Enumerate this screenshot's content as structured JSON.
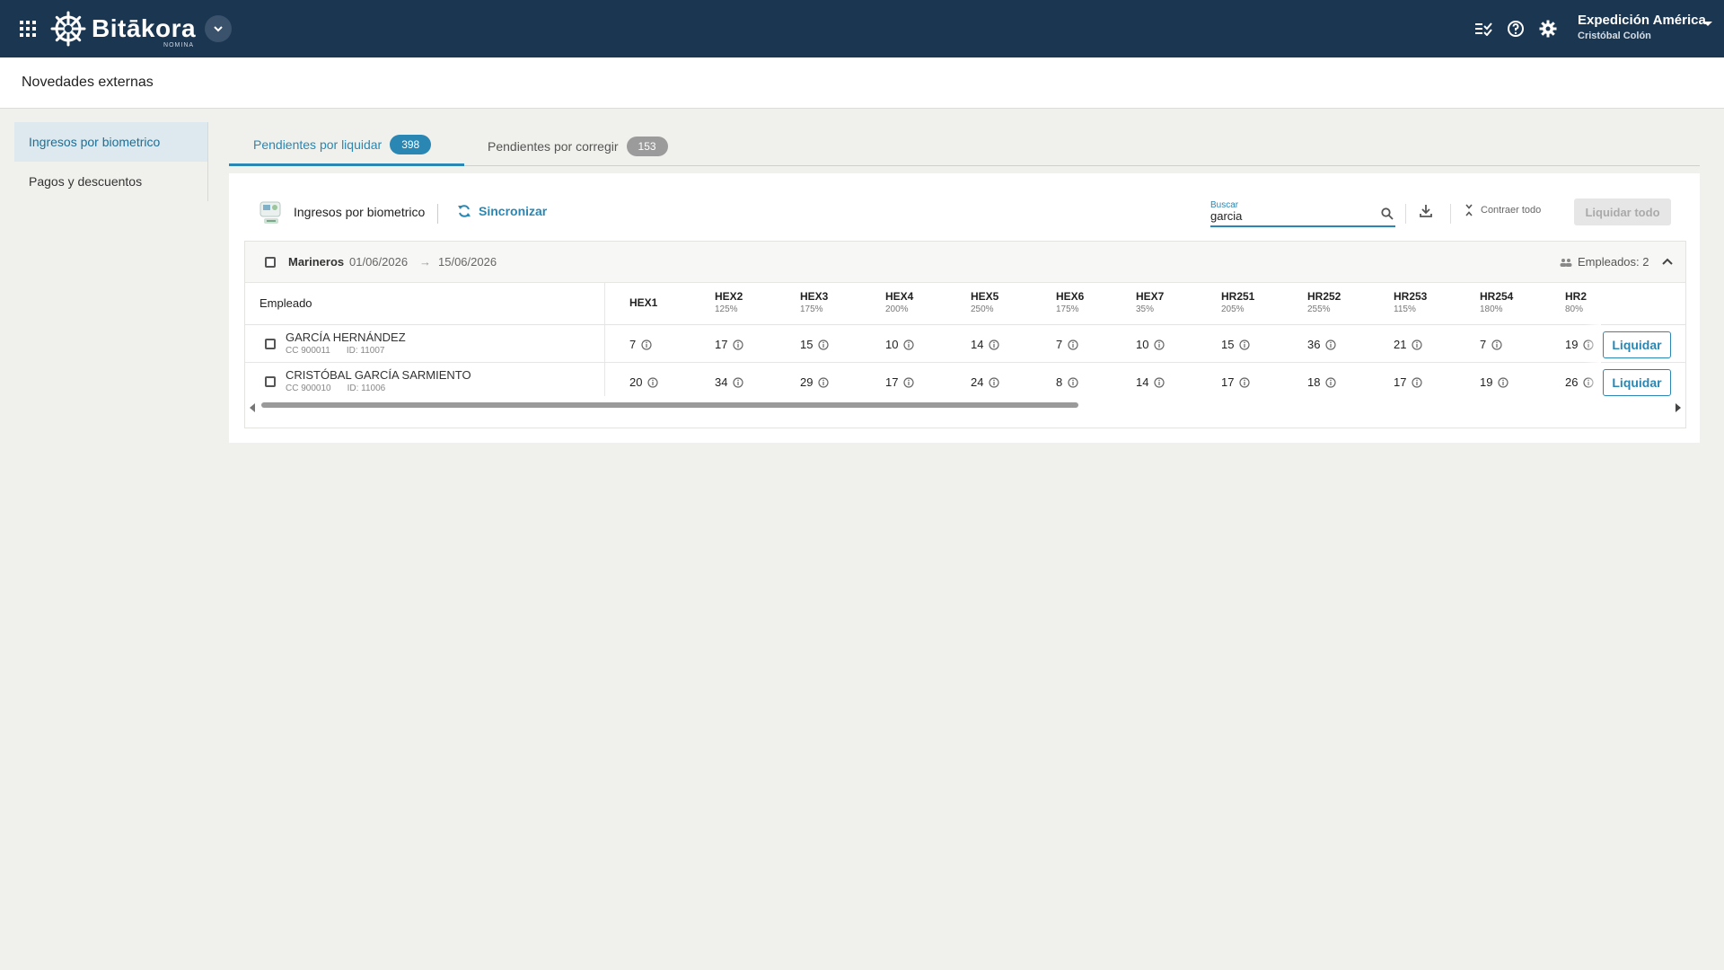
{
  "app": {
    "logo_name": "Bitākora",
    "logo_sub": "NOMINA",
    "company_name": "Expedición América",
    "user_name": "Cristóbal Colón",
    "icons": [
      "apps-grid-icon",
      "chevron-down-icon",
      "tasks-check-icon",
      "help-icon",
      "gear-icon",
      "caret-down-icon"
    ]
  },
  "page": {
    "title": "Novedades externas"
  },
  "sidebar": {
    "items": [
      {
        "label": "Ingresos por biometrico",
        "active": true
      },
      {
        "label": "Pagos y descuentos",
        "active": false
      }
    ]
  },
  "tabs": [
    {
      "label": "Pendientes por liquidar",
      "count": "398",
      "active": true
    },
    {
      "label": "Pendientes por corregir",
      "count": "153",
      "active": false
    }
  ],
  "toolbar": {
    "title": "Ingresos por biometrico",
    "sync_label": "Sincronizar",
    "search_label": "Buscar",
    "search_value": "garcia",
    "collapse_label": "Contraer todo",
    "liquidate_all_label": "Liquidar todo"
  },
  "group": {
    "name": "Marineros",
    "date_from": "01/06/2026",
    "arrow": "→",
    "date_to": "15/06/2026",
    "employees_label": "Empleados: 2"
  },
  "table": {
    "employee_header": "Empleado",
    "columns": [
      {
        "code": "HEX1",
        "pct": ""
      },
      {
        "code": "HEX2",
        "pct": "125%"
      },
      {
        "code": "HEX3",
        "pct": "175%"
      },
      {
        "code": "HEX4",
        "pct": "200%"
      },
      {
        "code": "HEX5",
        "pct": "250%"
      },
      {
        "code": "HEX6",
        "pct": "175%"
      },
      {
        "code": "HEX7",
        "pct": "35%"
      },
      {
        "code": "HR251",
        "pct": "205%"
      },
      {
        "code": "HR252",
        "pct": "255%"
      },
      {
        "code": "HR253",
        "pct": "115%"
      },
      {
        "code": "HR254",
        "pct": "180%"
      },
      {
        "code": "HR2",
        "pct": "80%"
      }
    ],
    "rows": [
      {
        "name": "GARCÍA HERNÁNDEZ",
        "cc": "CC 900011",
        "id": "ID: 11007",
        "values": [
          "7",
          "17",
          "15",
          "10",
          "14",
          "7",
          "10",
          "15",
          "36",
          "21",
          "7",
          "19"
        ],
        "action_label": "Liquidar"
      },
      {
        "name": "CRISTÓBAL GARCÍA SARMIENTO",
        "cc": "CC 900010",
        "id": "ID: 11006",
        "values": [
          "20",
          "34",
          "29",
          "17",
          "24",
          "8",
          "14",
          "17",
          "18",
          "17",
          "19",
          "26"
        ],
        "action_label": "Liquidar"
      }
    ]
  },
  "colors": {
    "topbar": "#1b3651",
    "accent": "#2a87b3",
    "badge_inactive": "#9b9b9b",
    "sidebar_active_bg": "#dde9ee"
  }
}
